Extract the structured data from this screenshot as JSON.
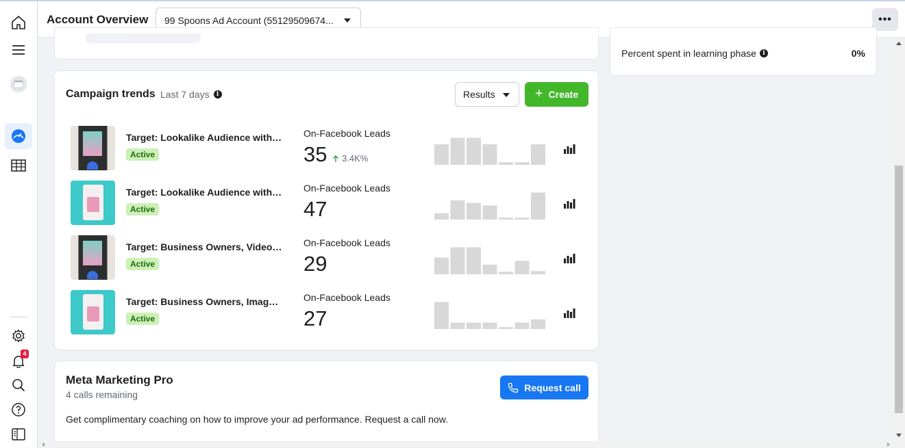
{
  "header": {
    "title": "Account Overview",
    "account_selector": "99 Spoons Ad Account (55129509674...",
    "more_label": "•••"
  },
  "nav": {
    "icons": [
      "home-icon",
      "menu-icon",
      "profile-avatar",
      "dashboard-icon",
      "table-icon",
      "settings-icon",
      "notifications-icon",
      "search-icon",
      "help-icon",
      "sidebar-toggle-icon"
    ],
    "notifications_count": "4",
    "active_item": "dashboard-icon"
  },
  "learning": {
    "label": "Percent spent in learning phase",
    "value": "0%"
  },
  "trends": {
    "title": "Campaign trends",
    "range": "Last 7 days",
    "metric_select": "Results",
    "create_label": "Create",
    "campaigns": [
      {
        "name": "Target: Lookalike Audience with V...",
        "status": "Active",
        "metric_label": "On-Facebook Leads",
        "value": "35",
        "delta": "3.4K%",
        "thumb": "video",
        "spark": [
          0.64,
          0.84,
          0.84,
          0.64,
          0.08,
          0.08,
          0.64
        ]
      },
      {
        "name": "Target: Lookalike Audience with I...",
        "status": "Active",
        "metric_label": "On-Facebook Leads",
        "value": "47",
        "delta": "",
        "thumb": "image",
        "spark": [
          0.2,
          0.6,
          0.52,
          0.44,
          0.06,
          0.06,
          0.84
        ]
      },
      {
        "name": "Target: Business Owners, Video C...",
        "status": "Active",
        "metric_label": "On-Facebook Leads",
        "value": "29",
        "delta": "",
        "thumb": "video",
        "spark": [
          0.52,
          0.84,
          0.84,
          0.3,
          0.08,
          0.42,
          0.1
        ]
      },
      {
        "name": "Target: Business Owners, Image C...",
        "status": "Active",
        "metric_label": "On-Facebook Leads",
        "value": "27",
        "delta": "",
        "thumb": "image",
        "spark": [
          0.84,
          0.2,
          0.2,
          0.2,
          0.06,
          0.2,
          0.3
        ]
      }
    ]
  },
  "meta": {
    "title": "Meta Marketing Pro",
    "subtitle": "4 calls remaining",
    "description": "Get complimentary coaching on how to improve your ad performance. Request a call now.",
    "cta": "Request call"
  },
  "colors": {
    "create_green": "#42b72a",
    "cta_blue": "#1877f2",
    "active_badge_bg": "#ccf0b6",
    "spark_bar": "#d8d8d8",
    "delta_green": "#31a24c"
  }
}
